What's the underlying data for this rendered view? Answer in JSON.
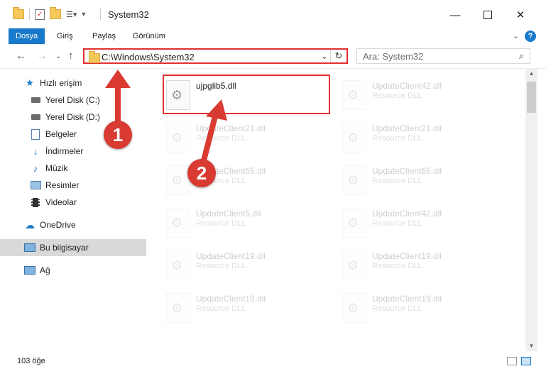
{
  "window": {
    "title": "System32"
  },
  "ribbon": {
    "tabs": [
      "Dosya",
      "Giriş",
      "Paylaş",
      "Görünüm"
    ],
    "help": "?"
  },
  "navigation": {
    "path": "C:\\Windows\\System32",
    "search_placeholder": "Ara: System32"
  },
  "sidebar": {
    "items": [
      {
        "label": "Hızlı erişim",
        "icon": "star-icon",
        "pinned": false
      },
      {
        "label": "Yerel Disk (C:)",
        "icon": "drive-icon",
        "pinned": true
      },
      {
        "label": "Yerel Disk (D:)",
        "icon": "drive-icon",
        "pinned": true
      },
      {
        "label": "Belgeler",
        "icon": "document-icon",
        "pinned": true
      },
      {
        "label": "İndirmeler",
        "icon": "download-icon",
        "pinned": true
      },
      {
        "label": "Müzik",
        "icon": "music-icon",
        "pinned": true
      },
      {
        "label": "Resimler",
        "icon": "pictures-icon",
        "pinned": true
      },
      {
        "label": "Videolar",
        "icon": "video-icon",
        "pinned": true
      },
      {
        "label": "OneDrive",
        "icon": "cloud-icon",
        "pinned": false
      },
      {
        "label": "Bu bilgisayar",
        "icon": "computer-icon",
        "pinned": false
      },
      {
        "label": "Ağ",
        "icon": "network-icon",
        "pinned": false
      }
    ]
  },
  "files": {
    "highlighted": {
      "name": "ujpglib5.dll"
    },
    "grid": [
      {
        "name": "UpdateClient42.dll",
        "type": "Resource DLL"
      },
      {
        "name": "UpdateClient21.dll",
        "type": "Resource DLL"
      },
      {
        "name": "UpdateClient21.dll",
        "type": "Resource DLL"
      },
      {
        "name": "UpdateClient65.dll",
        "type": "Resource DLL"
      },
      {
        "name": "UpdateClient65.dll",
        "type": "Resource DLL"
      },
      {
        "name": "UpdateClient5.dll",
        "type": "Resource DLL"
      },
      {
        "name": "UpdateClient42.dll",
        "type": "Resource DLL"
      },
      {
        "name": "UpdateClient19.dll",
        "type": "Resource DLL"
      },
      {
        "name": "UpdateClient19.dll",
        "type": "Resource DLL"
      },
      {
        "name": "UpdateClient19.dll",
        "type": "Resource DLL"
      },
      {
        "name": "UpdateClient19.dll",
        "type": "Resource DLL"
      }
    ]
  },
  "status": {
    "item_count": "103 öğe"
  },
  "annotations": {
    "step1": "1",
    "step2": "2",
    "color": "#d93a32"
  }
}
